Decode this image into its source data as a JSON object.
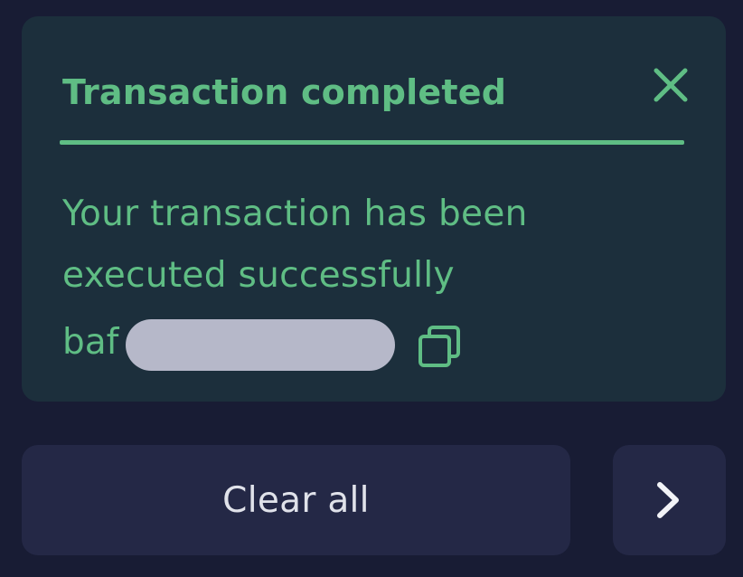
{
  "notification": {
    "title": "Transaction completed",
    "message": "Your transaction has been executed successfully",
    "hash_prefix": "baf",
    "close_icon": "close-icon",
    "copy_icon": "copy-icon",
    "accent_color": "#5fbd84",
    "background_color": "#1c2f3c"
  },
  "actions": {
    "clear_all_label": "Clear all",
    "next_icon": "chevron-right-icon"
  },
  "colors": {
    "page_background": "#181c34",
    "button_background": "#242846",
    "button_text": "#e0e2ea"
  }
}
